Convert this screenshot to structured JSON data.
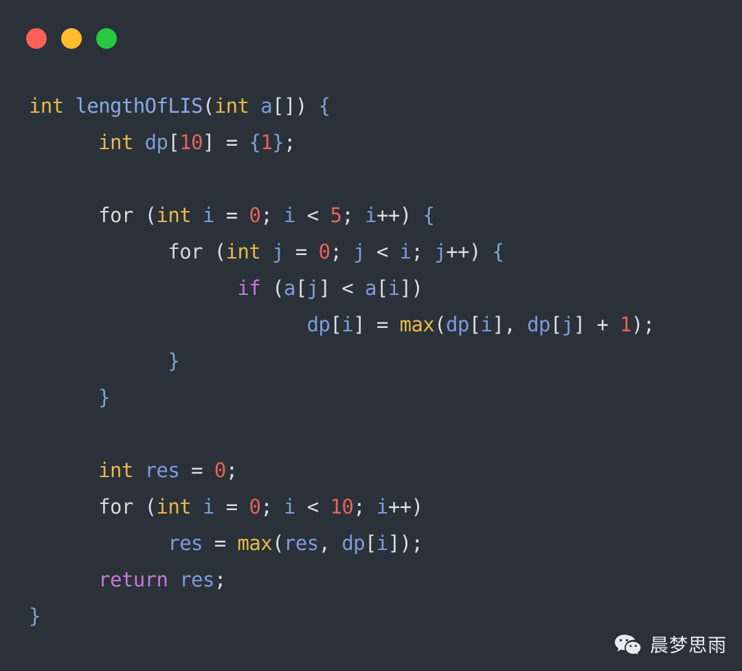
{
  "window": {
    "background_color": "#2a3138",
    "controls": [
      {
        "name": "close",
        "color": "#ff5f56",
        "label": "Close"
      },
      {
        "name": "minimize",
        "color": "#febc2e",
        "label": "Minimize"
      },
      {
        "name": "maximize",
        "color": "#28c840",
        "label": "Maximize"
      }
    ]
  },
  "theme": {
    "type_color": "#e8b84b",
    "function_color": "#8aa8e8",
    "variable_color": "#7d9cde",
    "number_color": "#e8625a",
    "keyword_color": "#d8d8d8",
    "control_color": "#c678dd",
    "punctuation_color": "#dcdfe4",
    "brace_color": "#7fa3d8",
    "builtin_color": "#e8b84b"
  },
  "code": {
    "language": "C",
    "plain_text": "int lengthOfLIS(int a[]) {\n      int dp[10] = {1};\n\n      for (int i = 0; i < 5; i++) {\n            for (int j = 0; j < i; j++) {\n                  if (a[j] < a[i])\n                        dp[i] = max(dp[i], dp[j] + 1);\n            }\n      }\n\n      int res = 0;\n      for (int i = 0; i < 10; i++)\n            res = max(res, dp[i]);\n      return res;\n}",
    "lines": [
      {
        "number": 1,
        "indent": 0,
        "tokens": [
          {
            "text": "int",
            "type": "type"
          },
          {
            "text": " ",
            "type": "punct"
          },
          {
            "text": "lengthOfLIS",
            "type": "fn"
          },
          {
            "text": "(",
            "type": "punct"
          },
          {
            "text": "int",
            "type": "type"
          },
          {
            "text": " ",
            "type": "punct"
          },
          {
            "text": "a",
            "type": "var"
          },
          {
            "text": "[]) ",
            "type": "punct"
          },
          {
            "text": "{",
            "type": "brace"
          }
        ]
      },
      {
        "number": 2,
        "indent": 1,
        "tokens": [
          {
            "text": "int",
            "type": "type"
          },
          {
            "text": " ",
            "type": "punct"
          },
          {
            "text": "dp",
            "type": "var"
          },
          {
            "text": "[",
            "type": "punct"
          },
          {
            "text": "10",
            "type": "num"
          },
          {
            "text": "] = ",
            "type": "punct"
          },
          {
            "text": "{",
            "type": "brace"
          },
          {
            "text": "1",
            "type": "num"
          },
          {
            "text": "}",
            "type": "brace"
          },
          {
            "text": ";",
            "type": "punct"
          }
        ]
      },
      {
        "number": 3,
        "indent": 0,
        "tokens": []
      },
      {
        "number": 4,
        "indent": 1,
        "tokens": [
          {
            "text": "for",
            "type": "kw"
          },
          {
            "text": " (",
            "type": "punct"
          },
          {
            "text": "int",
            "type": "type"
          },
          {
            "text": " ",
            "type": "punct"
          },
          {
            "text": "i",
            "type": "var"
          },
          {
            "text": " = ",
            "type": "punct"
          },
          {
            "text": "0",
            "type": "num"
          },
          {
            "text": "; ",
            "type": "punct"
          },
          {
            "text": "i",
            "type": "var"
          },
          {
            "text": " < ",
            "type": "punct"
          },
          {
            "text": "5",
            "type": "num"
          },
          {
            "text": "; ",
            "type": "punct"
          },
          {
            "text": "i",
            "type": "var"
          },
          {
            "text": "++) ",
            "type": "punct"
          },
          {
            "text": "{",
            "type": "brace"
          }
        ]
      },
      {
        "number": 5,
        "indent": 2,
        "tokens": [
          {
            "text": "for",
            "type": "kw"
          },
          {
            "text": " (",
            "type": "punct"
          },
          {
            "text": "int",
            "type": "type"
          },
          {
            "text": " ",
            "type": "punct"
          },
          {
            "text": "j",
            "type": "var"
          },
          {
            "text": " = ",
            "type": "punct"
          },
          {
            "text": "0",
            "type": "num"
          },
          {
            "text": "; ",
            "type": "punct"
          },
          {
            "text": "j",
            "type": "var"
          },
          {
            "text": " < ",
            "type": "punct"
          },
          {
            "text": "i",
            "type": "var"
          },
          {
            "text": "; ",
            "type": "punct"
          },
          {
            "text": "j",
            "type": "var"
          },
          {
            "text": "++) ",
            "type": "punct"
          },
          {
            "text": "{",
            "type": "brace"
          }
        ]
      },
      {
        "number": 6,
        "indent": 3,
        "tokens": [
          {
            "text": "if",
            "type": "ctrl"
          },
          {
            "text": " (",
            "type": "punct"
          },
          {
            "text": "a",
            "type": "var"
          },
          {
            "text": "[",
            "type": "punct"
          },
          {
            "text": "j",
            "type": "var"
          },
          {
            "text": "] < ",
            "type": "punct"
          },
          {
            "text": "a",
            "type": "var"
          },
          {
            "text": "[",
            "type": "punct"
          },
          {
            "text": "i",
            "type": "var"
          },
          {
            "text": "])",
            "type": "punct"
          }
        ]
      },
      {
        "number": 7,
        "indent": 4,
        "tokens": [
          {
            "text": "dp",
            "type": "var"
          },
          {
            "text": "[",
            "type": "punct"
          },
          {
            "text": "i",
            "type": "var"
          },
          {
            "text": "] = ",
            "type": "punct"
          },
          {
            "text": "max",
            "type": "builtin"
          },
          {
            "text": "(",
            "type": "punct"
          },
          {
            "text": "dp",
            "type": "var"
          },
          {
            "text": "[",
            "type": "punct"
          },
          {
            "text": "i",
            "type": "var"
          },
          {
            "text": "], ",
            "type": "punct"
          },
          {
            "text": "dp",
            "type": "var"
          },
          {
            "text": "[",
            "type": "punct"
          },
          {
            "text": "j",
            "type": "var"
          },
          {
            "text": "] + ",
            "type": "punct"
          },
          {
            "text": "1",
            "type": "num"
          },
          {
            "text": ");",
            "type": "punct"
          }
        ]
      },
      {
        "number": 8,
        "indent": 2,
        "tokens": [
          {
            "text": "}",
            "type": "brace"
          }
        ]
      },
      {
        "number": 9,
        "indent": 1,
        "tokens": [
          {
            "text": "}",
            "type": "brace"
          }
        ]
      },
      {
        "number": 10,
        "indent": 0,
        "tokens": []
      },
      {
        "number": 11,
        "indent": 1,
        "tokens": [
          {
            "text": "int",
            "type": "type"
          },
          {
            "text": " ",
            "type": "punct"
          },
          {
            "text": "res",
            "type": "var"
          },
          {
            "text": " = ",
            "type": "punct"
          },
          {
            "text": "0",
            "type": "num"
          },
          {
            "text": ";",
            "type": "punct"
          }
        ]
      },
      {
        "number": 12,
        "indent": 1,
        "tokens": [
          {
            "text": "for",
            "type": "kw"
          },
          {
            "text": " (",
            "type": "punct"
          },
          {
            "text": "int",
            "type": "type"
          },
          {
            "text": " ",
            "type": "punct"
          },
          {
            "text": "i",
            "type": "var"
          },
          {
            "text": " = ",
            "type": "punct"
          },
          {
            "text": "0",
            "type": "num"
          },
          {
            "text": "; ",
            "type": "punct"
          },
          {
            "text": "i",
            "type": "var"
          },
          {
            "text": " < ",
            "type": "punct"
          },
          {
            "text": "10",
            "type": "num"
          },
          {
            "text": "; ",
            "type": "punct"
          },
          {
            "text": "i",
            "type": "var"
          },
          {
            "text": "++)",
            "type": "punct"
          }
        ]
      },
      {
        "number": 13,
        "indent": 2,
        "tokens": [
          {
            "text": "res",
            "type": "var"
          },
          {
            "text": " = ",
            "type": "punct"
          },
          {
            "text": "max",
            "type": "builtin"
          },
          {
            "text": "(",
            "type": "punct"
          },
          {
            "text": "res",
            "type": "var"
          },
          {
            "text": ", ",
            "type": "punct"
          },
          {
            "text": "dp",
            "type": "var"
          },
          {
            "text": "[",
            "type": "punct"
          },
          {
            "text": "i",
            "type": "var"
          },
          {
            "text": "]);",
            "type": "punct"
          }
        ]
      },
      {
        "number": 14,
        "indent": 1,
        "tokens": [
          {
            "text": "return",
            "type": "ctrl"
          },
          {
            "text": " ",
            "type": "punct"
          },
          {
            "text": "res",
            "type": "var"
          },
          {
            "text": ";",
            "type": "punct"
          }
        ]
      },
      {
        "number": 15,
        "indent": 0,
        "tokens": [
          {
            "text": "}",
            "type": "brace"
          }
        ]
      }
    ]
  },
  "watermark": {
    "icon": "wechat-icon",
    "text": "晨梦思雨",
    "text_color": "#e9ecef"
  }
}
